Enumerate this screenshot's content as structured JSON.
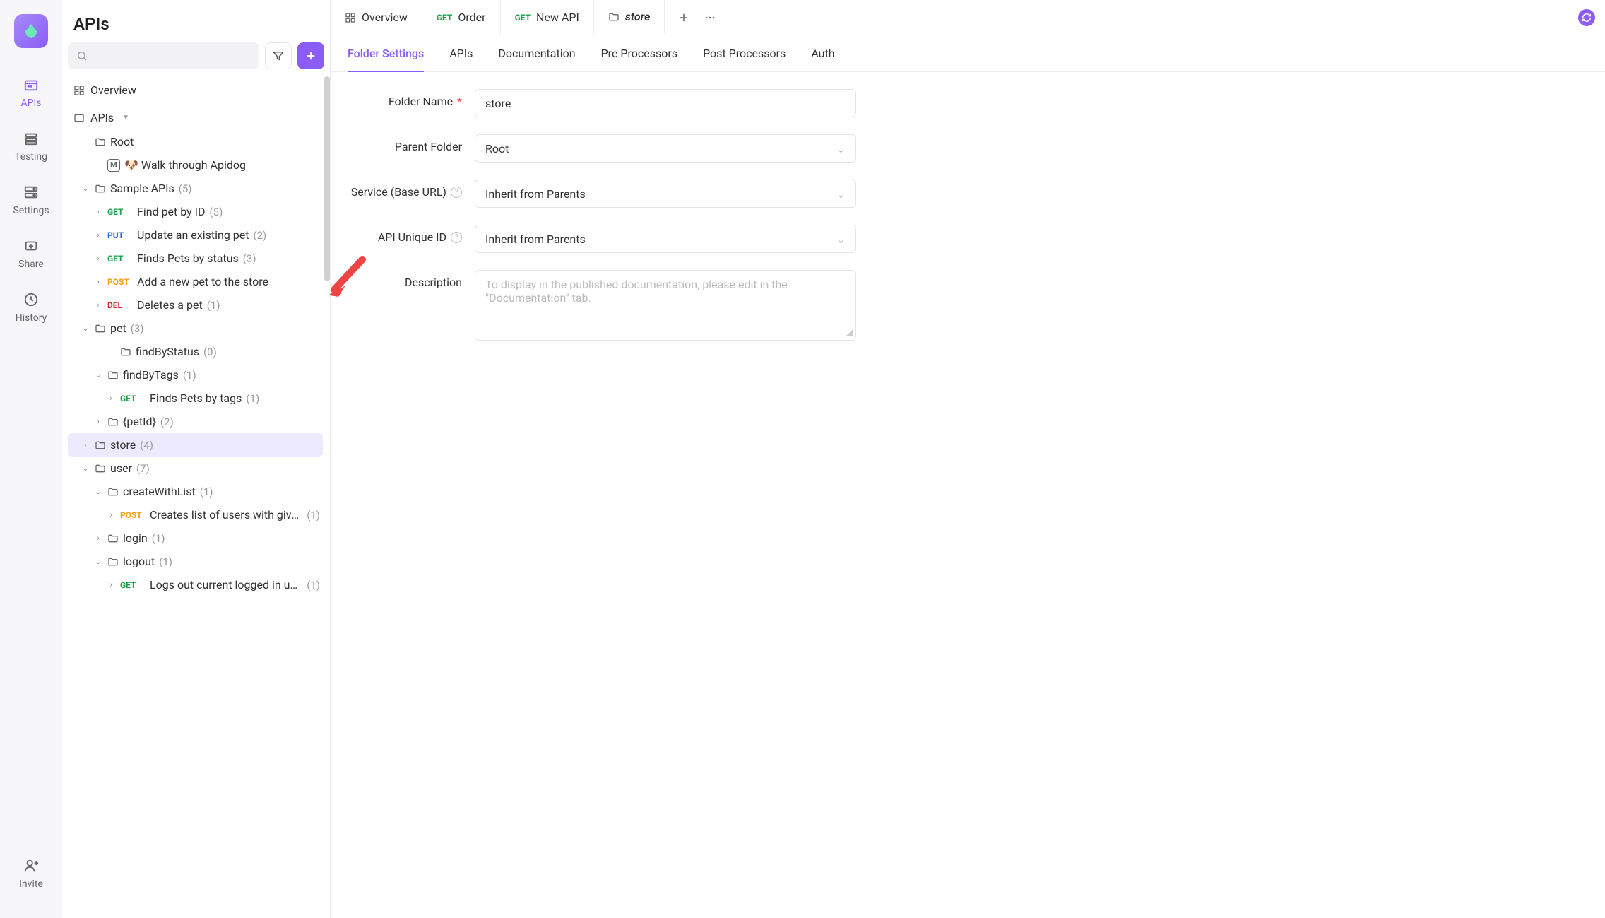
{
  "rail": {
    "items": [
      {
        "label": "APIs",
        "active": true,
        "icon": "apis"
      },
      {
        "label": "Testing",
        "active": false,
        "icon": "testing"
      },
      {
        "label": "Settings",
        "active": false,
        "icon": "settings"
      },
      {
        "label": "Share",
        "active": false,
        "icon": "share"
      },
      {
        "label": "History",
        "active": false,
        "icon": "history"
      }
    ],
    "invite": {
      "label": "Invite"
    }
  },
  "sidebar": {
    "title": "APIs",
    "overview": "Overview",
    "apis_label": "APIs",
    "tree": {
      "root": {
        "name": "Root"
      },
      "walk": {
        "name": "🐶 Walk through Apidog"
      },
      "sample": {
        "name": "Sample APIs",
        "count": "(5)"
      },
      "sample_children": [
        {
          "method": "GET",
          "name": "Find pet by ID",
          "count": "(5)"
        },
        {
          "method": "PUT",
          "name": "Update an existing pet",
          "count": "(2)"
        },
        {
          "method": "GET",
          "name": "Finds Pets by status",
          "count": "(3)"
        },
        {
          "method": "POST",
          "name": "Add a new pet to the store",
          "count": ""
        },
        {
          "method": "DEL",
          "name": "Deletes a pet",
          "count": "(1)"
        }
      ],
      "pet": {
        "name": "pet",
        "count": "(3)"
      },
      "findByStatus": {
        "name": "findByStatus",
        "count": "(0)"
      },
      "findByTags": {
        "name": "findByTags",
        "count": "(1)"
      },
      "findByTagsChild": {
        "method": "GET",
        "name": "Finds Pets by tags",
        "count": "(1)"
      },
      "petId": {
        "name": "{petId}",
        "count": "(2)"
      },
      "store": {
        "name": "store",
        "count": "(4)"
      },
      "user": {
        "name": "user",
        "count": "(7)"
      },
      "createWithList": {
        "name": "createWithList",
        "count": "(1)"
      },
      "createWithListChild": {
        "method": "POST",
        "name": "Creates list of users with given ...",
        "count": "(1)"
      },
      "login": {
        "name": "login",
        "count": "(1)"
      },
      "logout": {
        "name": "logout",
        "count": "(1)"
      },
      "logoutChild": {
        "method": "GET",
        "name": "Logs out current logged in user...",
        "count": "(1)"
      }
    }
  },
  "tabs": [
    {
      "type": "overview",
      "label": "Overview"
    },
    {
      "type": "api",
      "method": "GET",
      "label": "Order"
    },
    {
      "type": "api",
      "method": "GET",
      "label": "New API"
    },
    {
      "type": "folder",
      "label": "store",
      "active": true
    }
  ],
  "subtabs": [
    "Folder Settings",
    "APIs",
    "Documentation",
    "Pre Processors",
    "Post Processors",
    "Auth"
  ],
  "subtab_active": 0,
  "form": {
    "folder_name": {
      "label": "Folder Name",
      "value": "store"
    },
    "parent_folder": {
      "label": "Parent Folder",
      "value": "Root"
    },
    "service": {
      "label": "Service (Base URL)",
      "value": "Inherit from Parents"
    },
    "api_unique_id": {
      "label": "API Unique ID",
      "value": "Inherit from Parents"
    },
    "description": {
      "label": "Description",
      "placeholder": "To display in the published documentation, please edit in the \"Documentation\" tab."
    }
  }
}
